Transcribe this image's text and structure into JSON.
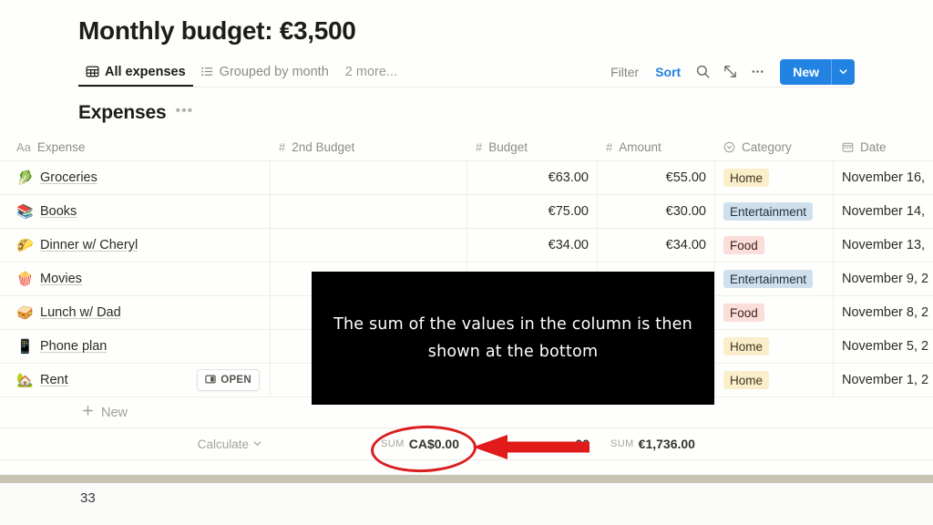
{
  "page": {
    "title": "Monthly budget: €3,500",
    "page_number": "33"
  },
  "views": {
    "tabs": [
      {
        "label": "All expenses",
        "icon": "table-icon",
        "active": true
      },
      {
        "label": "Grouped by month",
        "icon": "list-icon",
        "active": false
      }
    ],
    "more_label": "2 more..."
  },
  "toolbar": {
    "filter_label": "Filter",
    "sort_label": "Sort",
    "sort_color": "#2382e2",
    "search_icon": "search-icon",
    "expand_icon": "expand-icon",
    "more_icon": "more-horizontal-icon",
    "new_label": "New",
    "new_chevron": "chevron-down-icon",
    "new_color": "#2383e2"
  },
  "database": {
    "name": "Expenses",
    "options_icon": "more-horizontal-icon",
    "columns": [
      {
        "key": "expense",
        "label": "Expense",
        "type_icon": "Aa"
      },
      {
        "key": "budget2",
        "label": "2nd Budget",
        "type_icon": "#"
      },
      {
        "key": "budget",
        "label": "Budget",
        "type_icon": "#"
      },
      {
        "key": "amount",
        "label": "Amount",
        "type_icon": "#"
      },
      {
        "key": "category",
        "label": "Category",
        "type_icon": "select-icon"
      },
      {
        "key": "date",
        "label": "Date",
        "type_icon": "calendar-icon"
      }
    ],
    "rows": [
      {
        "emoji": "🥬",
        "name": "Groceries",
        "budget2": "",
        "budget": "€63.00",
        "amount": "€55.00",
        "category": "Home",
        "category_style": "tag-home",
        "date": "November 16,"
      },
      {
        "emoji": "📚",
        "name": "Books",
        "budget2": "",
        "budget": "€75.00",
        "amount": "€30.00",
        "category": "Entertainment",
        "category_style": "tag-ent",
        "date": "November 14,"
      },
      {
        "emoji": "🌮",
        "name": "Dinner w/ Cheryl",
        "budget2": "",
        "budget": "€34.00",
        "amount": "€34.00",
        "category": "Food",
        "category_style": "tag-food",
        "date": "November 13,"
      },
      {
        "emoji": "🍿",
        "name": "Movies",
        "budget2": "",
        "budget": "",
        "amount": "",
        "category": "Entertainment",
        "category_style": "tag-ent",
        "date": "November 9, 2"
      },
      {
        "emoji": "🥪",
        "name": "Lunch w/ Dad",
        "budget2": "",
        "budget": "",
        "amount": "",
        "category": "Food",
        "category_style": "tag-food",
        "date": "November 8, 2"
      },
      {
        "emoji": "📱",
        "name": "Phone plan",
        "budget2": "",
        "budget": "",
        "amount": "",
        "category": "Home",
        "category_style": "tag-home",
        "date": "November 5, 2"
      },
      {
        "emoji": "🏡",
        "name": "Rent",
        "budget2": "",
        "budget": "",
        "amount": "",
        "category": "Home",
        "category_style": "tag-home",
        "date": "November 1, 2",
        "open_label": "OPEN",
        "open_icon": "open-page-icon"
      }
    ],
    "new_row_label": "New",
    "new_row_icon": "plus-icon",
    "footer": {
      "calculate_label": "Calculate",
      "calculate_chevron": "chevron-down-icon",
      "budget2_sum_label": "SUM",
      "budget2_sum_value": "CA$0.00",
      "budget_sum_label": "",
      "budget_sum_value": "00",
      "amount_sum_label": "SUM",
      "amount_sum_value": "€1,736.00"
    }
  },
  "caption": {
    "line1": "The sum of the values in the column is then",
    "line2": "shown at the bottom"
  },
  "annotations": {
    "ellipse_color": "#d91f1f",
    "arrow_color": "#e01b19",
    "ellipse_target": "budget2-sum",
    "arrow_direction": "left"
  }
}
